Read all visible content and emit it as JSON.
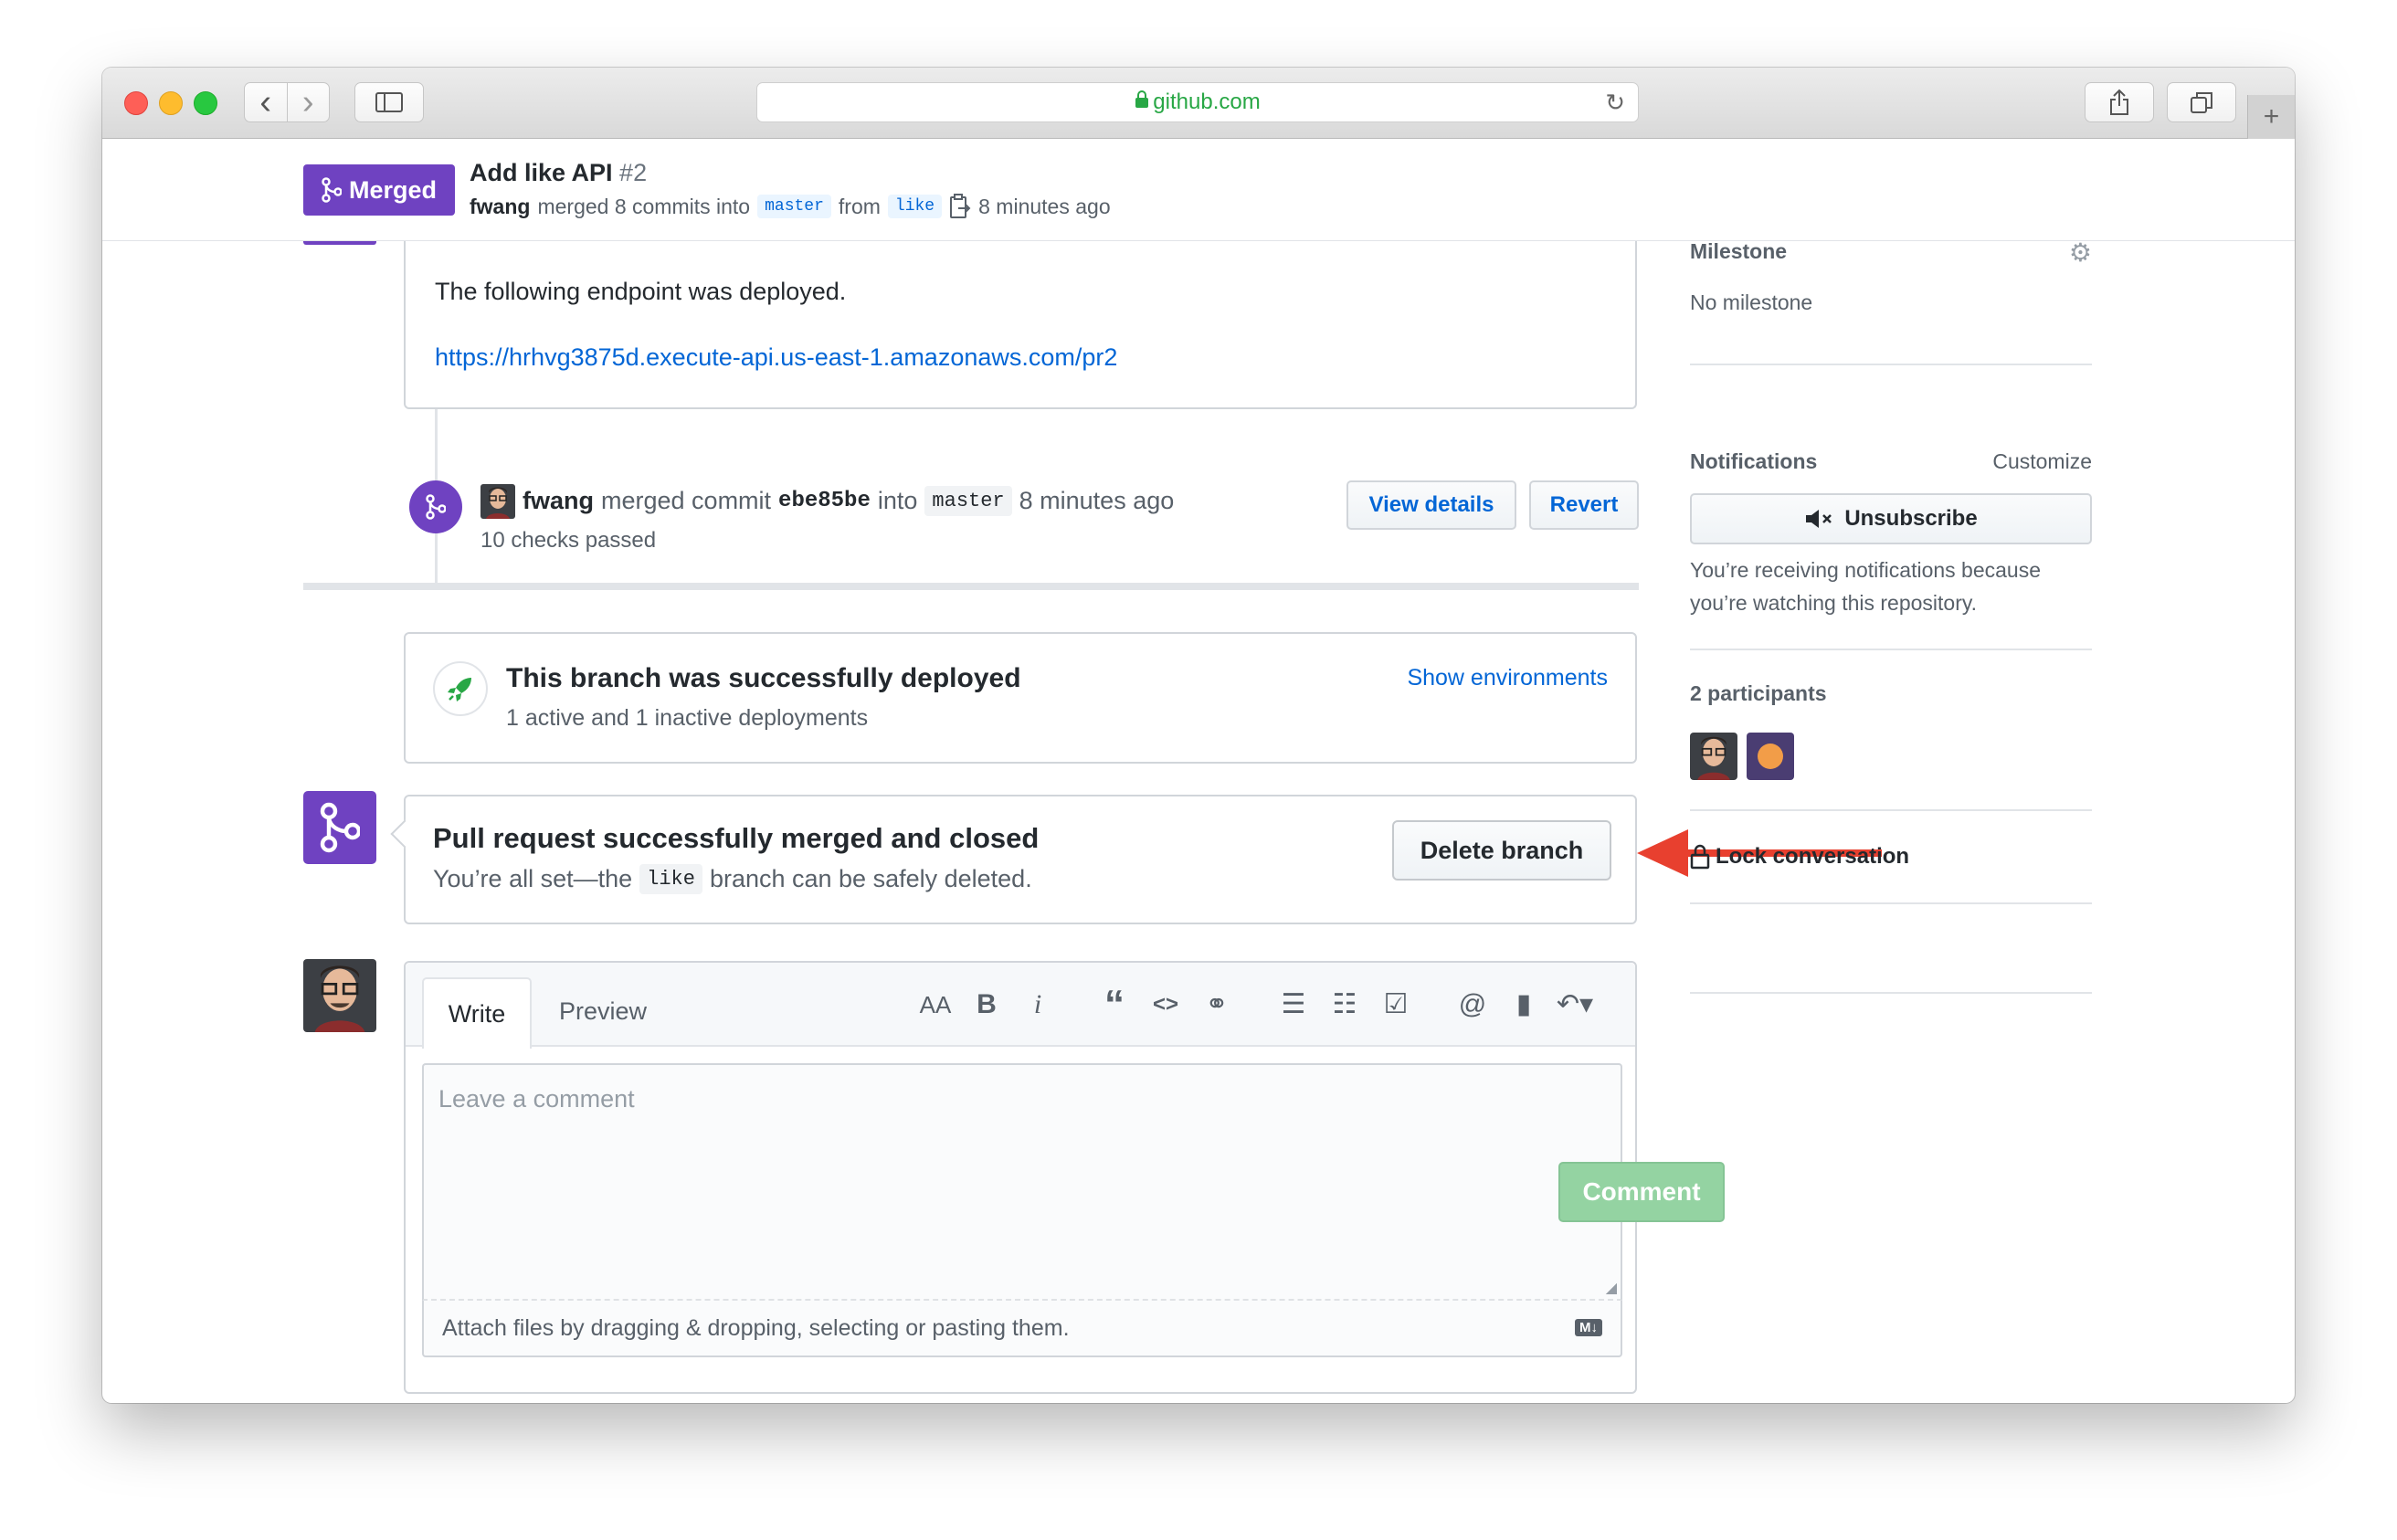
{
  "browser": {
    "url_domain": "github.com",
    "nav_back": "‹",
    "nav_forward": "›",
    "reload_glyph": "↻",
    "new_tab": "+"
  },
  "header": {
    "state_label": "Merged",
    "title": "Add like API",
    "number": "#2",
    "author": "fwang",
    "merged_text": "merged 8 commits into",
    "base_branch": "master",
    "from_text": "from",
    "head_branch": "like",
    "time": "8 minutes ago"
  },
  "comment": {
    "line1": "The following endpoint was deployed.",
    "link": "https://hrhvg3875d.execute-api.us-east-1.amazonaws.com/pr2"
  },
  "merge_event": {
    "author": "fwang",
    "action": "merged commit",
    "sha": "ebe85be",
    "into": "into",
    "branch": "master",
    "time": "8 minutes ago",
    "checks": "10 checks passed",
    "view_details": "View details",
    "revert": "Revert"
  },
  "deployment": {
    "title": "This branch was successfully deployed",
    "subtitle": "1 active and 1 inactive deployments",
    "show_env": "Show environments"
  },
  "merged_status": {
    "title": "Pull request successfully merged and closed",
    "sub_before": "You’re all set—the",
    "branch": "like",
    "sub_after": "branch can be safely deleted.",
    "delete_button": "Delete branch"
  },
  "editor": {
    "tab_write": "Write",
    "tab_preview": "Preview",
    "placeholder": "Leave a comment",
    "attach_hint": "Attach files by dragging & dropping, selecting or pasting them.",
    "markdown_badge": "M↓",
    "submit": "Comment",
    "tools": {
      "heading": "AA",
      "bold": "B",
      "italic": "i",
      "quote": "“",
      "code": "<>",
      "link": "⚭",
      "ul": "☰",
      "ol": "☷",
      "tasks": "☑",
      "mention": "@",
      "bookmark": "▮",
      "reply": "↶▾"
    }
  },
  "sidebar": {
    "milestone_title": "Milestone",
    "milestone_value": "No milestone",
    "notifications_title": "Notifications",
    "customize": "Customize",
    "unsubscribe": "Unsubscribe",
    "notif_reason": "You’re receiving notifications because you’re watching this repository.",
    "participants_title": "2 participants",
    "lock": "Lock conversation"
  },
  "colors": {
    "merged_purple": "#6f42c1",
    "link_blue": "#0366d6",
    "success_green": "#28a745",
    "arrow_red": "#e8402f"
  }
}
